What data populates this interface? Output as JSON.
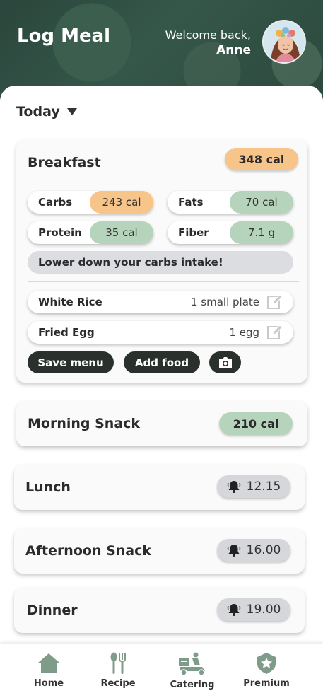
{
  "header": {
    "title": "Log Meal",
    "welcome": "Welcome back,",
    "user_name": "Anne"
  },
  "date_selector": {
    "label": "Today"
  },
  "breakfast": {
    "title": "Breakfast",
    "calories": "348 cal",
    "nutrients": [
      {
        "label": "Carbs",
        "value": "243 cal",
        "color": "#f7c48a"
      },
      {
        "label": "Fats",
        "value": "70 cal",
        "color": "#b6d4bc"
      },
      {
        "label": "Protein",
        "value": "35 cal",
        "color": "#b6d4bc"
      },
      {
        "label": "Fiber",
        "value": "7.1 g",
        "color": "#b6d4bc"
      }
    ],
    "warning": "Lower down your carbs intake!",
    "foods": [
      {
        "name": "White Rice",
        "qty": "1 small plate"
      },
      {
        "name": "Fried Egg",
        "qty": "1 egg"
      }
    ],
    "save_label": "Save menu",
    "add_label": "Add food"
  },
  "meals": [
    {
      "title": "Morning Snack",
      "badge": "210 cal",
      "kind": "calories",
      "color": "#b6d4bc"
    },
    {
      "title": "Lunch",
      "badge": "12.15",
      "kind": "reminder"
    },
    {
      "title": "Afternoon Snack",
      "badge": "16.00",
      "kind": "reminder"
    },
    {
      "title": "Dinner",
      "badge": "19.00",
      "kind": "reminder"
    }
  ],
  "nav": [
    {
      "label": "Home",
      "icon": "home-icon"
    },
    {
      "label": "Recipe",
      "icon": "fork-spoon-icon"
    },
    {
      "label": "Catering",
      "icon": "delivery-scooter-icon"
    },
    {
      "label": "Premium",
      "icon": "premium-badge-icon"
    }
  ],
  "colors": {
    "accent_orange": "#f7c48a",
    "accent_green": "#b6d4bc",
    "dark_button": "#2a302c",
    "header_bg": "#2f4a40",
    "nav_icon": "#7f9b8a"
  }
}
